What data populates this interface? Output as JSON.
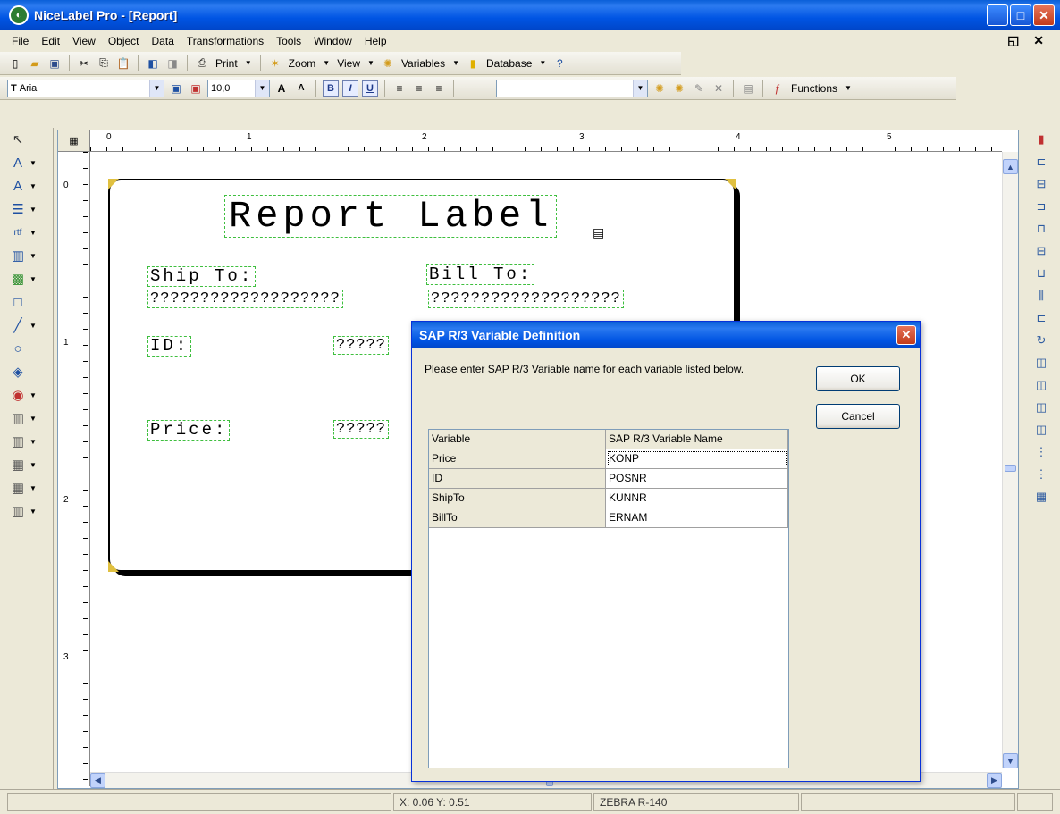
{
  "window": {
    "title": "NiceLabel Pro - [Report]"
  },
  "menu": {
    "items": [
      "File",
      "Edit",
      "View",
      "Object",
      "Data",
      "Transformations",
      "Tools",
      "Window",
      "Help"
    ],
    "mdi_controls": "_ ◱ ✕"
  },
  "toolbar1": {
    "print": "Print",
    "zoom": "Zoom",
    "view": "View",
    "variables": "Variables",
    "database": "Database"
  },
  "toolbar2": {
    "font_name": "Arial",
    "font_size": "10,0",
    "functions": "Functions"
  },
  "rulers": {
    "horizontal": [
      "0",
      "1",
      "2",
      "3",
      "4",
      "5"
    ],
    "vertical": [
      "0",
      "1",
      "2",
      "3"
    ]
  },
  "label": {
    "title": "Report Label",
    "ship_to": "Ship To:",
    "bill_to": "Bill To:",
    "ship_value": "???????????????????",
    "bill_value": "???????????????????",
    "id": "ID:",
    "id_value": "?????",
    "price": "Price:",
    "price_value": "?????"
  },
  "dialog": {
    "title": "SAP R/3 Variable Definition",
    "prompt": "Please enter SAP R/3 Variable name for each variable listed below.",
    "ok": "OK",
    "cancel": "Cancel",
    "columns": [
      "Variable",
      "SAP R/3 Variable Name"
    ],
    "rows": [
      {
        "variable": "Price",
        "sap_name": "KONP"
      },
      {
        "variable": "ID",
        "sap_name": "POSNR"
      },
      {
        "variable": "ShipTo",
        "sap_name": "KUNNR"
      },
      {
        "variable": "BillTo",
        "sap_name": "ERNAM"
      }
    ]
  },
  "status": {
    "coords": "X: 0.06 Y: 0.51",
    "printer": "ZEBRA R-140"
  }
}
